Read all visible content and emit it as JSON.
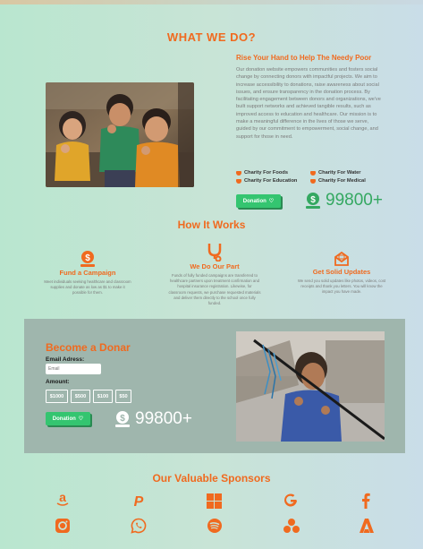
{
  "colors": {
    "accent": "#f06a1f",
    "green": "#34c570",
    "panel": "#9fb6ad"
  },
  "what_we_do": {
    "heading": "WHAT WE DO?",
    "subtitle": "Rise Your Hand to Help The Needy Poor",
    "paragraph": "Our donation website empowers communities and fosters social change by connecting donors with impactful projects. We aim to increase accessibility to donations, raise awareness about social issues, and ensure transparency in the donation process. By facilitating engagement between donors and organizations, we've built support networks and achieved tangible results, such as improved access to education and healthcare. Our mission is to make a meaningful difference in the lives of those we serve, guided by our commitment to empowerment, social change, and support for those in need.",
    "charities": [
      "Charity For Foods",
      "Charity For Water",
      "Charity For Education",
      "Charity For Medical"
    ],
    "donation_label": "Donation",
    "donation_icon": "heart-icon",
    "amount": "99800+"
  },
  "how_it_works": {
    "heading": "How It Works",
    "steps": [
      {
        "icon": "dollar-hand-icon",
        "title": "Fund a Campaign",
        "desc": "Meet individuals seeking healthcare and classroom supplies and donate as low as $1 to make it possible for them."
      },
      {
        "icon": "stethoscope-icon",
        "title": "We Do Our Part",
        "desc": "Funds of fully funded campaigns are transferred to healthcare partners upon treatment confirmation and hospital insurance registration. Likewise, for classroom requests, we purchase requested materials and deliver them directly to the school once fully funded."
      },
      {
        "icon": "mail-icon",
        "title": "Get Solid Updates",
        "desc": "We send you solid updates like photos, videos, cost receipts and thank you letters. You will know the impact you have made."
      }
    ]
  },
  "donate": {
    "heading": "Become a Donar",
    "email_label": "Email Adress:",
    "email_placeholder": "Email",
    "amount_label": "Amount:",
    "amounts": [
      "$1000",
      "$500",
      "$100",
      "$50"
    ],
    "donation_label": "Donation",
    "amount": "99800+"
  },
  "sponsors": {
    "heading": "Our Valuable Sponsors",
    "icons": [
      "amazon-icon",
      "paypal-icon",
      "windows-icon",
      "google-icon",
      "facebook-icon",
      "instagram-icon",
      "whatsapp-icon",
      "spotify-icon",
      "cocacola-dots-icon",
      "adobe-icon"
    ]
  }
}
